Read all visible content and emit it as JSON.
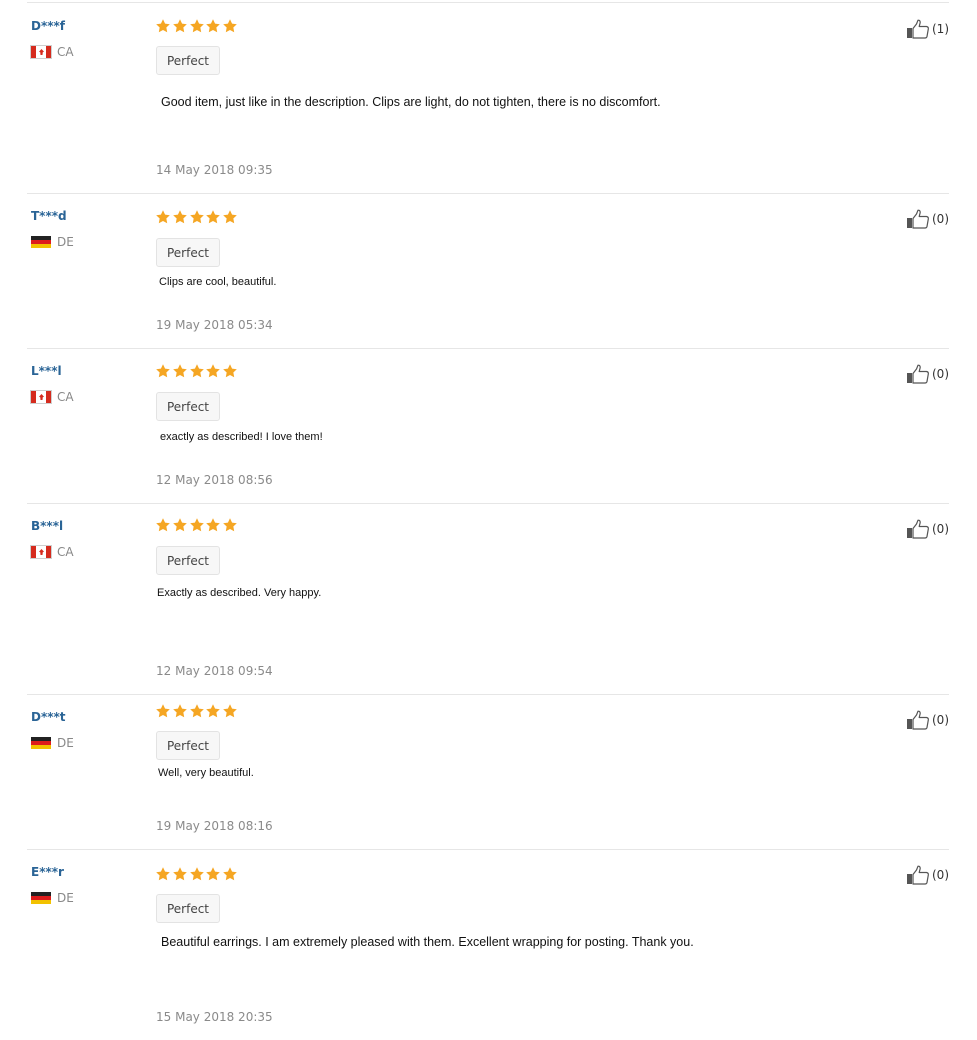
{
  "colors": {
    "username": "#2a6496",
    "star": "#f5a623",
    "country_text": "#888888",
    "date_text": "#8a8a8a",
    "divider": "#e6e6e6"
  },
  "icons": {
    "star": "star-icon",
    "like": "thumbs-up-icon",
    "flag": "flag-icon"
  },
  "reviews": [
    {
      "user": "D***f",
      "flag": "ca",
      "country": "CA",
      "rating": 5,
      "badge": "Perfect",
      "text": "Good item, just like in the description. Clips are light, do not tighten, there is no discomfort.",
      "date": "14 May 2018 09:35",
      "helpful": "(1)"
    },
    {
      "user": "T***d",
      "flag": "de",
      "country": "DE",
      "rating": 5,
      "badge": "Perfect",
      "text": "Clips are cool, beautiful.",
      "date": "19 May 2018 05:34",
      "helpful": "(0)"
    },
    {
      "user": "L***l",
      "flag": "ca",
      "country": "CA",
      "rating": 5,
      "badge": "Perfect",
      "text": "exactly as described! I love them!",
      "date": "12 May 2018 08:56",
      "helpful": "(0)"
    },
    {
      "user": "B***l",
      "flag": "ca",
      "country": "CA",
      "rating": 5,
      "badge": "Perfect",
      "text": "Exactly as described. Very happy.",
      "date": "12 May 2018 09:54",
      "helpful": "(0)"
    },
    {
      "user": "D***t",
      "flag": "de",
      "country": "DE",
      "rating": 5,
      "badge": "Perfect",
      "text": "Well, very beautiful.",
      "date": "19 May 2018 08:16",
      "helpful": "(0)"
    },
    {
      "user": "E***r",
      "flag": "de",
      "country": "DE",
      "rating": 5,
      "badge": "Perfect",
      "text": "Beautiful earrings. I am extremely pleased with them. Excellent wrapping for posting. Thank you.",
      "date": "15 May 2018 20:35",
      "helpful": "(0)"
    }
  ]
}
